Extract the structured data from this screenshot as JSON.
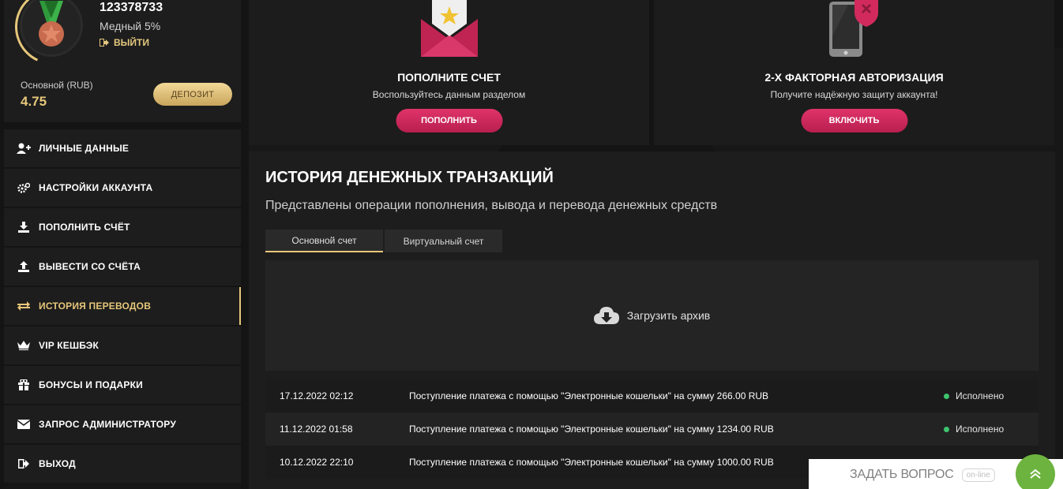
{
  "profile": {
    "user_id": "123378733",
    "level": "Медный 5%",
    "logout": "ВЫЙТИ",
    "balance_label": "Основной (RUB)",
    "balance_value": "4.75",
    "deposit_label": "ДЕПОЗИТ"
  },
  "menu": [
    {
      "label": "ЛИЧНЫЕ ДАННЫЕ",
      "icon": "user-add-icon"
    },
    {
      "label": "НАСТРОЙКИ АККАУНТА",
      "icon": "gears-icon"
    },
    {
      "label": "ПОПОЛНИТЬ СЧЁТ",
      "icon": "download-icon"
    },
    {
      "label": "ВЫВЕСТИ СО СЧЁТА",
      "icon": "upload-icon"
    },
    {
      "label": "ИСТОРИЯ ПЕРЕВОДОВ",
      "icon": "transfer-icon",
      "active": true
    },
    {
      "label": "VIP КЕШБЭК",
      "icon": "crown-icon"
    },
    {
      "label": "БОНУСЫ И ПОДАРКИ",
      "icon": "gift-icon"
    },
    {
      "label": "ЗАПРОС АДМИНИСТРАТОРУ",
      "icon": "envelope-icon"
    },
    {
      "label": "ВЫХОД",
      "icon": "logout-icon"
    }
  ],
  "cards": {
    "deposit": {
      "title": "ПОПОЛНИТЕ СЧЕТ",
      "subtitle": "Воспользуйтесь данным разделом",
      "button": "ПОПОЛНИТЬ",
      "icon": "envelope-star-icon"
    },
    "twofa": {
      "title": "2-Х ФАКТОРНАЯ АВТОРИЗАЦИЯ",
      "subtitle": "Получите надёжную защиту аккаунта!",
      "button": "ВКЛЮЧИТЬ",
      "icon": "phone-shield-icon"
    }
  },
  "history": {
    "title": "ИСТОРИЯ ДЕНЕЖНЫХ ТРАНЗАКЦИЙ",
    "description": "Представлены операции пополнения, вывода и перевода денежных средств",
    "tabs": [
      "Основной счет",
      "Виртуальный счет"
    ],
    "archive_label": "Загрузить архив",
    "transactions": [
      {
        "date": "17.12.2022 02:12",
        "description": "Поступление платежа с помощью \"Электронные кошельки\" на сумму 266.00 RUB",
        "status": "Исполнено"
      },
      {
        "date": "11.12.2022 01:58",
        "description": "Поступление платежа с помощью \"Электронные кошельки\" на сумму 1234.00 RUB",
        "status": "Исполнено"
      },
      {
        "date": "10.12.2022 22:10",
        "description": "Поступление платежа с помощью \"Электронные кошельки\" на сумму 1000.00 RUB",
        "status": ""
      }
    ]
  },
  "ask_widget": {
    "label": "ЗАДАТЬ ВОПРОС",
    "badge": "on-line"
  },
  "colors": {
    "accent_gold": "#e6c77a",
    "accent_pink": "#d22a5d",
    "status_green": "#3ec46d",
    "widget_green": "#6db33f"
  }
}
